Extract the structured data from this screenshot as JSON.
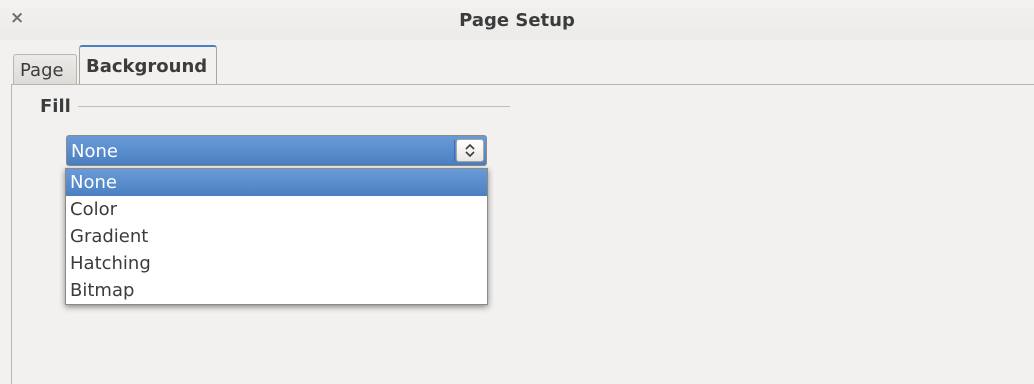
{
  "window": {
    "title": "Page Setup",
    "close_glyph": "×"
  },
  "tabs": [
    {
      "label": "Page",
      "active": false
    },
    {
      "label": "Background",
      "active": true
    }
  ],
  "fill": {
    "section_label": "Fill",
    "selected_value": "None",
    "options": [
      "None",
      "Color",
      "Gradient",
      "Hatching",
      "Bitmap"
    ],
    "highlighted_index": 0
  },
  "colors": {
    "selection": "#4a7fc1",
    "dialog_bg": "#f2f1f0"
  }
}
